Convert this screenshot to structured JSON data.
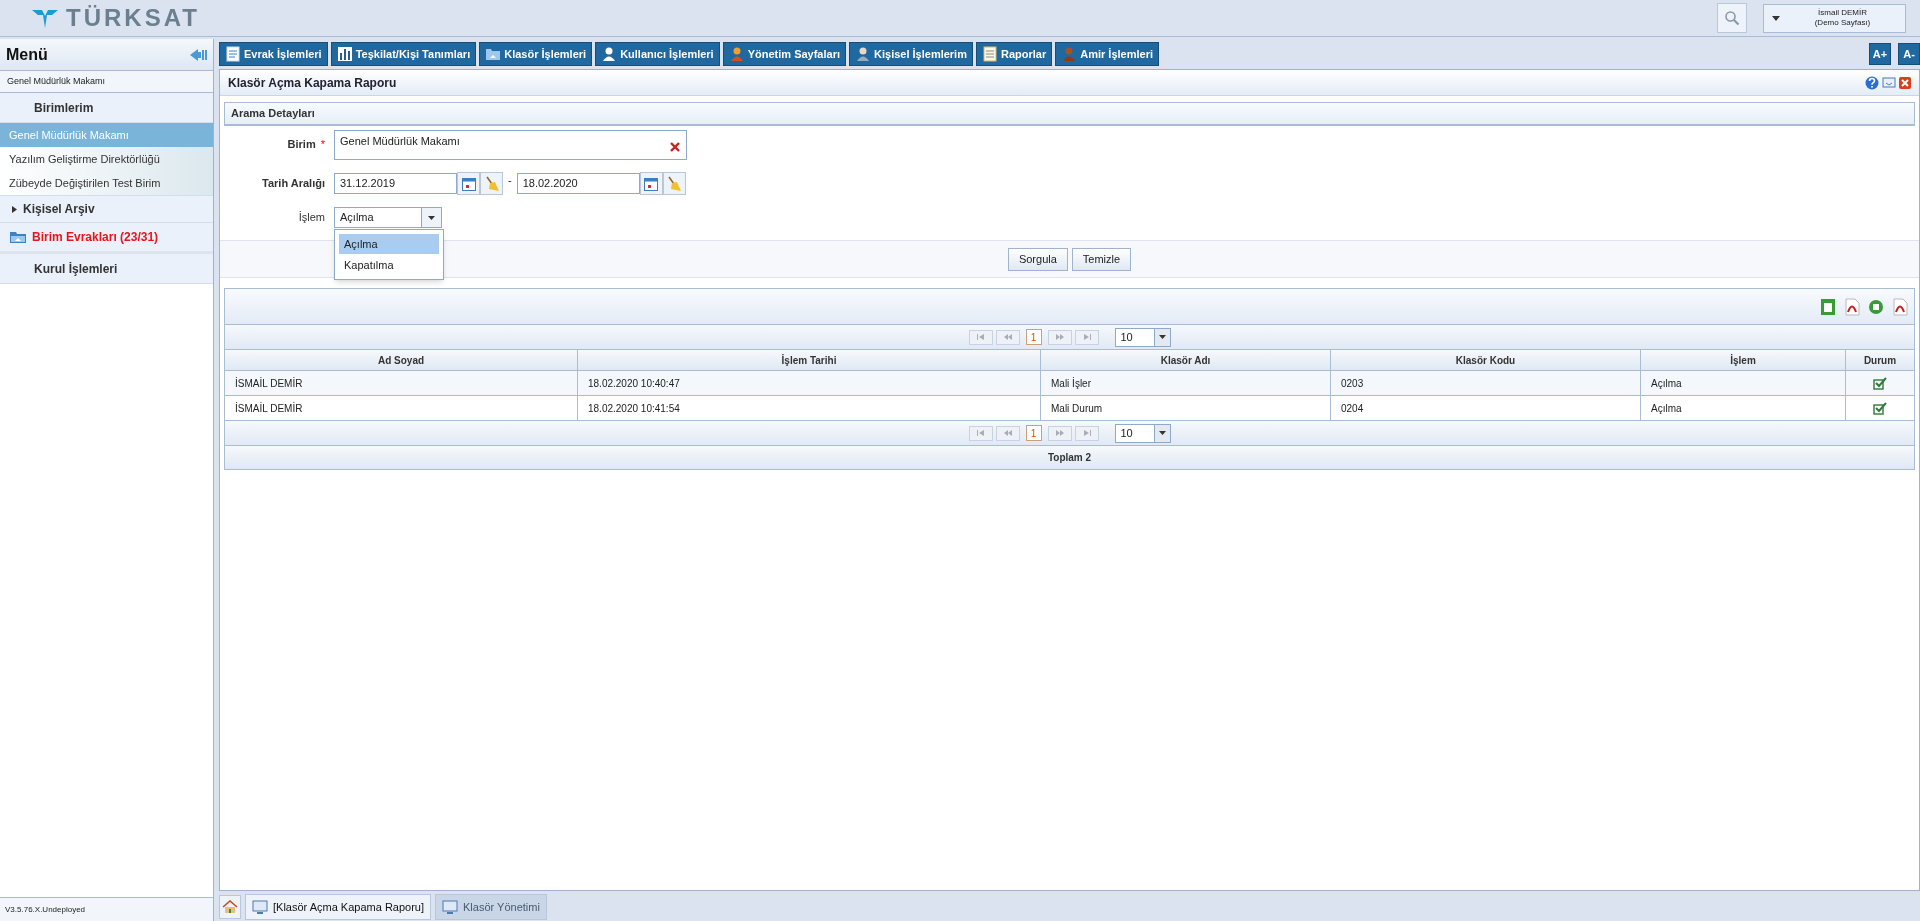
{
  "header": {
    "logo_text": "TÜRKSAT",
    "user": {
      "name": "İsmail DEMİR",
      "subtitle": "(Demo Sayfası)"
    }
  },
  "sidebar": {
    "title": "Menü",
    "current_unit": "Genel Müdürlük Makamı",
    "sections": [
      {
        "kind": "group",
        "label": "Birimlerim",
        "items": [
          {
            "label": "Genel Müdürlük Makamı",
            "selected": true
          },
          {
            "label": "Yazılım Geliştirme Direktörlüğü",
            "selected": false
          },
          {
            "label": "Zübeyde Değiştirilen Test Birim",
            "selected": false
          }
        ]
      },
      {
        "kind": "expander",
        "label": "Kişisel Arşiv",
        "expanded": false
      },
      {
        "kind": "alert",
        "label": "Birim Evrakları (23/31)"
      },
      {
        "kind": "heading",
        "label": "Kurul İşlemleri"
      }
    ],
    "version": "V3.5.76.X.Undeployed"
  },
  "toolbar": {
    "menus": [
      "Evrak İşlemleri",
      "Teşkilat/Kişi Tanımları",
      "Klasör İşlemleri",
      "Kullanıcı İşlemleri",
      "Yönetim Sayfaları",
      "Kişisel İşlemlerim",
      "Raporlar",
      "Amir İşlemleri"
    ],
    "font_buttons": [
      "A+",
      "A-"
    ]
  },
  "panel": {
    "title": "Klasör Açma Kapama Raporu",
    "search": {
      "title": "Arama Detayları",
      "unit": {
        "label": "Birim",
        "required_mark": "*",
        "value": "Genel Müdürlük Makamı"
      },
      "date_range": {
        "label": "Tarih Aralığı",
        "start": "31.12.2019",
        "separator": "-",
        "end": "18.02.2020"
      },
      "operation": {
        "label": "İşlem",
        "value": "Açılma",
        "expanded": true,
        "options": [
          {
            "label": "Açılma",
            "selected": true
          },
          {
            "label": "Kapatılma",
            "selected": false
          }
        ]
      },
      "buttons": [
        "Sorgula",
        "Temizle"
      ]
    },
    "results": {
      "pager_top": {
        "page": "1",
        "page_size": "10"
      },
      "columns": [
        "Ad Soyad",
        "İşlem Tarihi",
        "Klasör Adı",
        "Klasör Kodu",
        "İşlem",
        "Durum"
      ],
      "rows": [
        {
          "cells": [
            "İSMAİL DEMİR",
            "18.02.2020 10:40:47",
            "Mali İşler",
            "0203",
            "Açılma"
          ]
        },
        {
          "cells": [
            "İSMAİL DEMİR",
            "18.02.2020 10:41:54",
            "Mali Durum",
            "0204",
            "Açılma"
          ]
        }
      ],
      "pager_bottom": {
        "page": "1",
        "page_size": "10"
      },
      "total": "Toplam 2"
    }
  },
  "taskbar": {
    "tabs": [
      {
        "label": "[Klasör Açma Kapama Raporu]",
        "selected": true
      },
      {
        "label": "Klasör Yönetimi",
        "selected": false
      }
    ]
  }
}
